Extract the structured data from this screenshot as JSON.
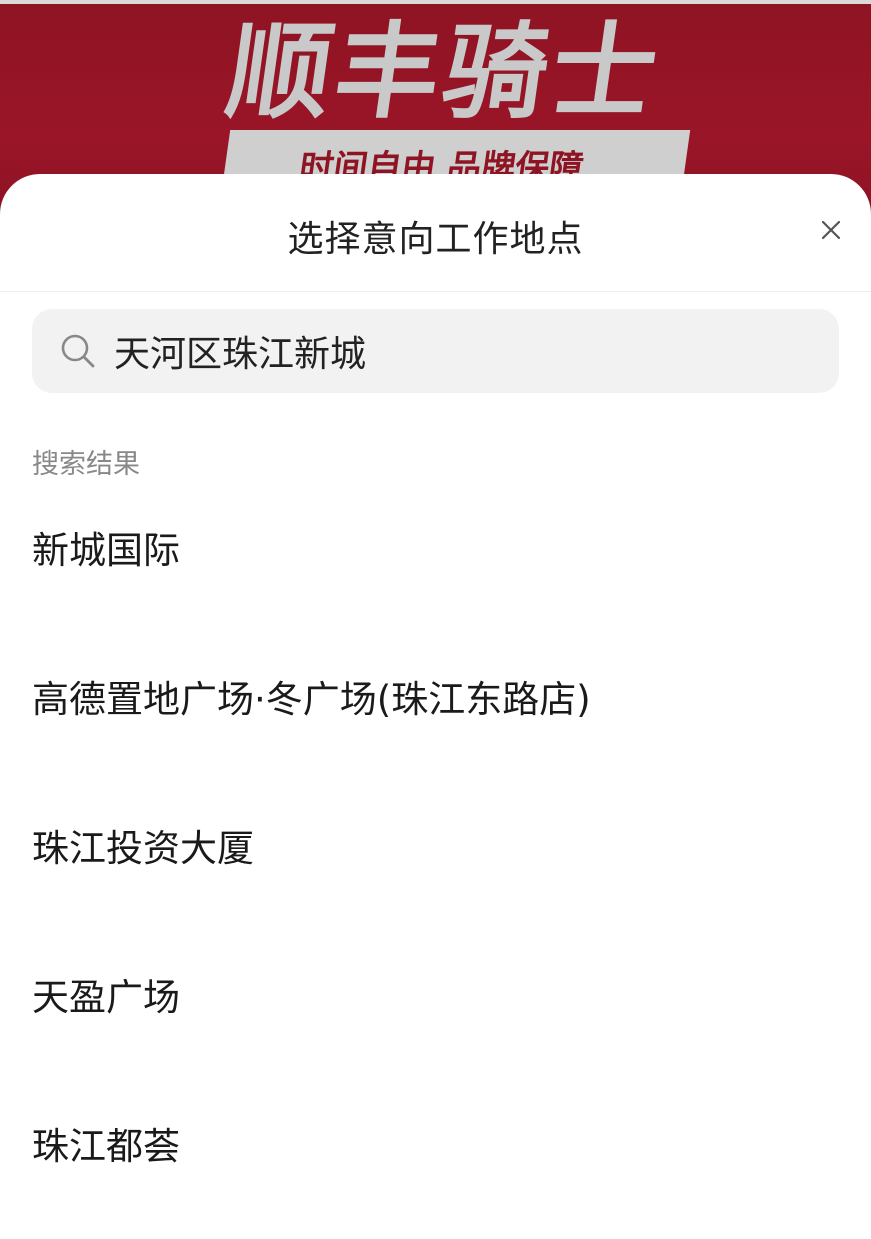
{
  "banner": {
    "title": "顺丰骑士",
    "subtitle": "时间自由 品牌保障"
  },
  "sheet": {
    "title": "选择意向工作地点",
    "close_icon": "close-icon"
  },
  "search": {
    "icon": "search-icon",
    "value": "天河区珠江新城"
  },
  "results": {
    "label": "搜索结果",
    "items": [
      {
        "name": "新城国际"
      },
      {
        "name": "高德置地广场·冬广场(珠江东路店)"
      },
      {
        "name": "珠江投资大厦"
      },
      {
        "name": "天盈广场"
      },
      {
        "name": "珠江都荟"
      }
    ]
  }
}
